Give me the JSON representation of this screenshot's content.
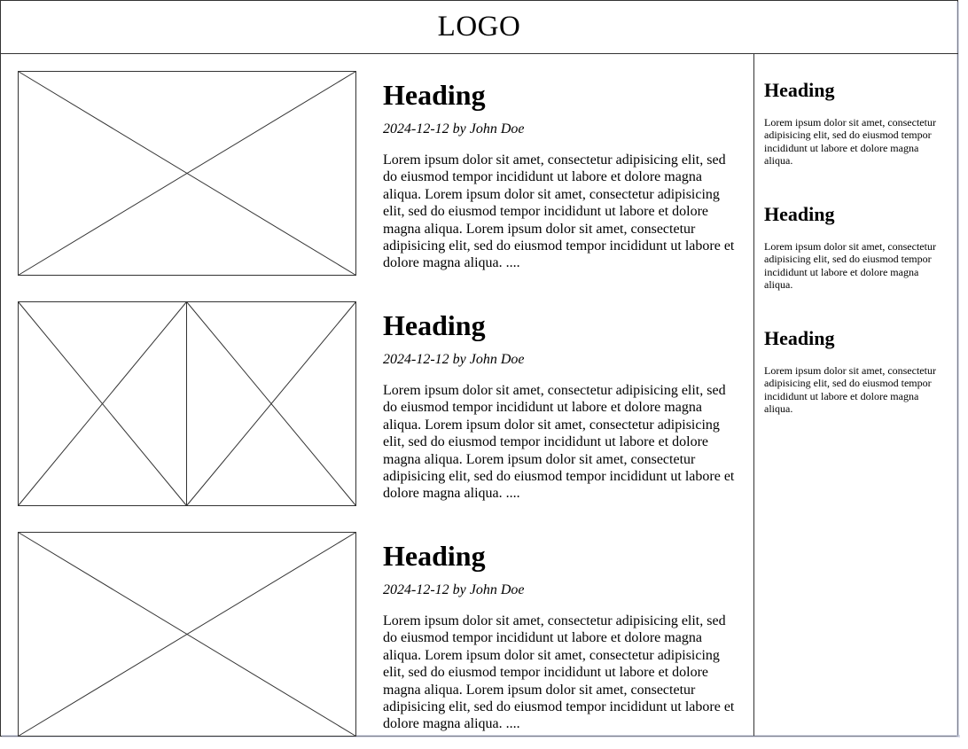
{
  "header": {
    "logo": "LOGO"
  },
  "posts": [
    {
      "heading": "Heading",
      "meta": "2024-12-12 by John Doe",
      "body": "Lorem ipsum dolor sit amet, consectetur adipisicing elit, sed do eiusmod tempor incididunt ut labore et dolore magna aliqua. Lorem ipsum dolor sit amet, consectetur adipisicing elit, sed do eiusmod tempor incididunt ut labore et dolore magna aliqua. Lorem ipsum dolor sit amet, consectetur adipisicing elit, sed do eiusmod tempor incididunt ut labore et dolore magna aliqua. ....",
      "media": "single-image-placeholder"
    },
    {
      "heading": "Heading",
      "meta": "2024-12-12 by John Doe",
      "body": "Lorem ipsum dolor sit amet, consectetur adipisicing elit, sed do eiusmod tempor incididunt ut labore et dolore magna aliqua. Lorem ipsum dolor sit amet, consectetur adipisicing elit, sed do eiusmod tempor incididunt ut labore et dolore magna aliqua. Lorem ipsum dolor sit amet, consectetur adipisicing elit, sed do eiusmod tempor incididunt ut labore et dolore magna aliqua. ....",
      "media": "double-image-placeholder"
    },
    {
      "heading": "Heading",
      "meta": "2024-12-12 by John Doe",
      "body": "Lorem ipsum dolor sit amet, consectetur adipisicing elit, sed do eiusmod tempor incididunt ut labore et dolore magna aliqua. Lorem ipsum dolor sit amet, consectetur adipisicing elit, sed do eiusmod tempor incididunt ut labore et dolore magna aliqua. Lorem ipsum dolor sit amet, consectetur adipisicing elit, sed do eiusmod tempor incididunt ut labore et dolore magna aliqua. ....",
      "media": "single-image-placeholder"
    }
  ],
  "sidebar": {
    "items": [
      {
        "heading": "Heading",
        "body": "Lorem ipsum dolor sit amet, consectetur adipisicing elit, sed do eiusmod tempor incididunt ut labore et dolore magna aliqua."
      },
      {
        "heading": "Heading",
        "body": "Lorem ipsum dolor sit amet, consectetur adipisicing elit, sed do eiusmod tempor incididunt ut labore et dolore magna aliqua."
      },
      {
        "heading": "Heading",
        "body": "Lorem ipsum dolor sit amet, consectetur adipisicing elit, sed do eiusmod tempor incididunt ut labore et dolore magna aliqua."
      }
    ]
  },
  "colors": {
    "line": "#333333",
    "background": "#ffffff",
    "shadow": "#b9bfd6"
  }
}
